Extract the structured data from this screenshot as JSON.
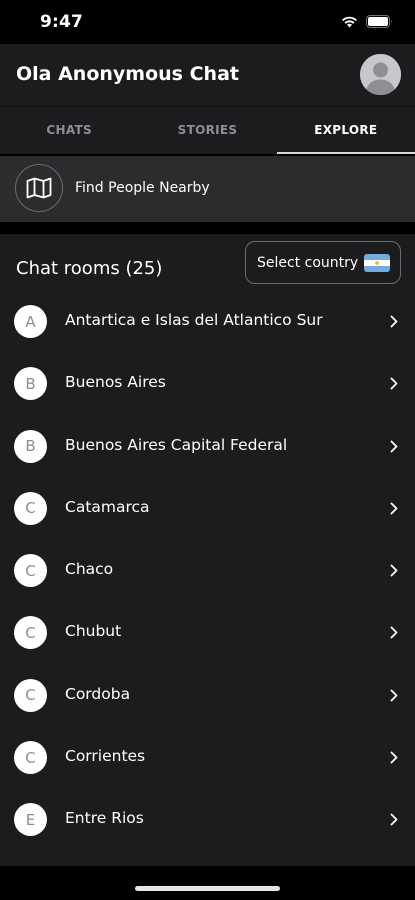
{
  "status_bar": {
    "time": "9:47",
    "icons": [
      "signal-icon",
      "wifi-icon",
      "battery-icon"
    ]
  },
  "header": {
    "title": "Ola Anonymous Chat",
    "avatar": "avatar-placeholder-icon"
  },
  "tabs": [
    {
      "label": "CHATS",
      "active": false
    },
    {
      "label": "STORIES",
      "active": false
    },
    {
      "label": "EXPLORE",
      "active": true
    }
  ],
  "nearby": {
    "icon": "map-icon",
    "label": "Find People Nearby"
  },
  "rooms": {
    "title": "Chat rooms (25)",
    "country_button_label": "Select country",
    "country_flag": "argentina-flag-icon",
    "items": [
      {
        "letter": "A",
        "name": "Antartica e Islas del Atlantico Sur"
      },
      {
        "letter": "B",
        "name": "Buenos Aires"
      },
      {
        "letter": "B",
        "name": "Buenos Aires Capital Federal"
      },
      {
        "letter": "C",
        "name": "Catamarca"
      },
      {
        "letter": "C",
        "name": "Chaco"
      },
      {
        "letter": "C",
        "name": "Chubut"
      },
      {
        "letter": "C",
        "name": "Cordoba"
      },
      {
        "letter": "C",
        "name": "Corrientes"
      },
      {
        "letter": "E",
        "name": "Entre Rios"
      }
    ]
  },
  "colors": {
    "background": "#000000",
    "surface": "#1c1c1e",
    "surface_alt": "#2c2c2e",
    "muted_text": "#8e8e93"
  }
}
